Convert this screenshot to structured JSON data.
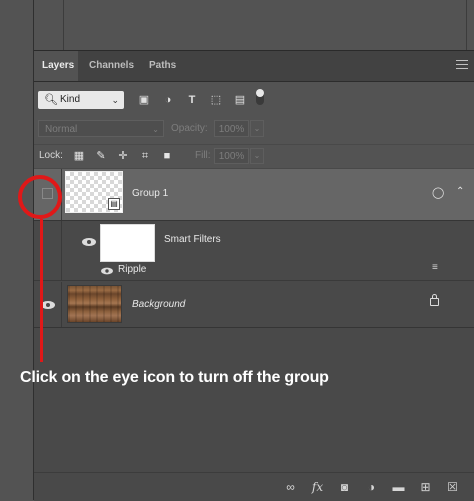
{
  "panel": {
    "tabs": [
      {
        "label": "Layers",
        "active": true
      },
      {
        "label": "Channels",
        "active": false
      },
      {
        "label": "Paths",
        "active": false
      }
    ],
    "menu_icon": "hamburger-icon"
  },
  "filter_row": {
    "kind_label": "Kind",
    "icons": [
      "pixel-layer-filter-icon",
      "adjustment-layer-filter-icon",
      "type-layer-filter-icon",
      "shape-layer-filter-icon",
      "smart-object-filter-icon"
    ]
  },
  "blend_row": {
    "blend_mode": "Normal",
    "opacity_label": "Opacity:",
    "opacity_value": "100%"
  },
  "lock_row": {
    "lock_label": "Lock:",
    "icons": [
      "lock-transparent-pixels-icon",
      "lock-image-pixels-icon",
      "lock-position-icon",
      "lock-artboard-icon",
      "lock-all-icon"
    ],
    "fill_label": "Fill:",
    "fill_value": "100%"
  },
  "layers": {
    "group": {
      "name": "Group 1",
      "visible": false,
      "selected": true
    },
    "smart_filters": {
      "name": "Smart Filters",
      "filter_name": "Ripple",
      "visible": true
    },
    "background": {
      "name": "Background",
      "visible": true,
      "locked": true
    }
  },
  "bottom_bar": {
    "icons": [
      "link-layers-icon",
      "fx-icon",
      "add-mask-icon",
      "new-fill-adjustment-icon",
      "new-group-icon",
      "new-layer-icon",
      "delete-icon"
    ]
  },
  "annotation": {
    "text": "Click on the eye icon to turn off the group",
    "color": "#e01818"
  },
  "colors": {
    "panel_bg": "#494949",
    "selected_layer_bg": "#666666",
    "annotation_red": "#e01818"
  }
}
